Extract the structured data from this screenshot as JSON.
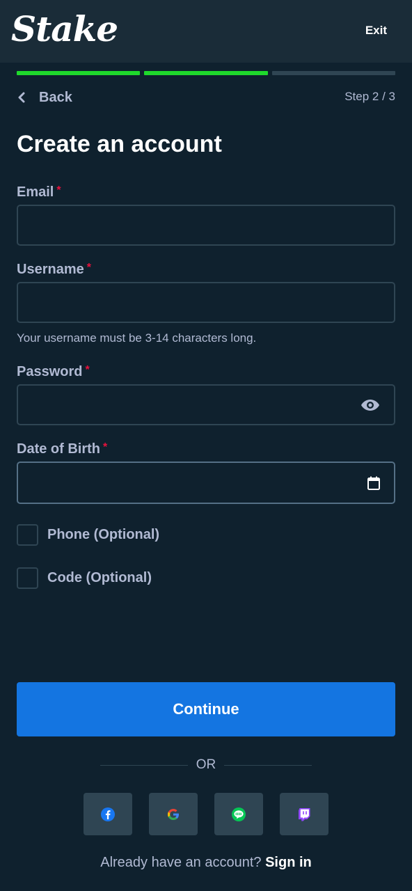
{
  "header": {
    "logo": "Stake",
    "exit_label": "Exit"
  },
  "progress": {
    "current_step": 2,
    "total_steps": 3,
    "done_color": "#1fd92c",
    "todo_color": "#2f4553"
  },
  "nav": {
    "back_label": "Back",
    "step_label": "Step 2 / 3"
  },
  "title": "Create an account",
  "form": {
    "required_mark": "*",
    "email": {
      "label": "Email",
      "value": ""
    },
    "username": {
      "label": "Username",
      "value": "",
      "hint": "Your username must be 3-14 characters long."
    },
    "password": {
      "label": "Password",
      "value": "",
      "icon": "eye-icon"
    },
    "dob": {
      "label": "Date of Birth",
      "value": "",
      "icon": "calendar-icon"
    },
    "phone_checkbox": {
      "label": "Phone (Optional)",
      "checked": false
    },
    "code_checkbox": {
      "label": "Code (Optional)",
      "checked": false
    }
  },
  "continue_label": "Continue",
  "or_label": "OR",
  "socials": [
    {
      "name": "facebook",
      "icon": "facebook-icon",
      "color": "#1877f2"
    },
    {
      "name": "google",
      "icon": "google-icon",
      "color": "#4285f4"
    },
    {
      "name": "line",
      "icon": "line-icon",
      "color": "#06c755"
    },
    {
      "name": "twitch",
      "icon": "twitch-icon",
      "color": "#9146ff"
    }
  ],
  "footer": {
    "prompt": "Already have an account?",
    "signin_label": "Sign in"
  },
  "colors": {
    "background": "#0f212e",
    "header": "#1a2c38",
    "accent": "#1475e1",
    "required": "#e9113c",
    "muted": "#b1bad3"
  }
}
